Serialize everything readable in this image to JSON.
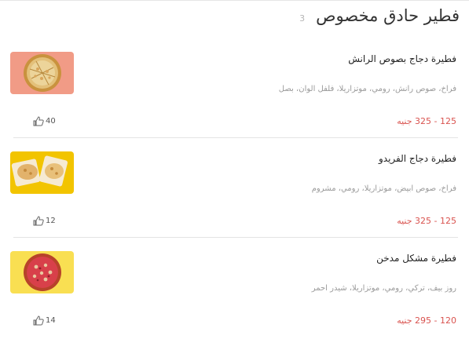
{
  "section": {
    "title": "فطير حادق مخصوص",
    "count": "3"
  },
  "items": [
    {
      "name": "فطيرة دجاج بصوص الرانش",
      "description": "فراخ، صوص رانش، رومي، موتزاريلا، فلفل الوان، بصل",
      "price": "125 - 325 جنيه",
      "likes": "40",
      "image_bg": "#f19b86",
      "image_icon": "pizza-ranch-image"
    },
    {
      "name": "فطيرة دجاج الفريدو",
      "description": "فراخ، صوص ابيض، موتزاريلا، رومي، مشروم",
      "price": "125 - 325 جنيه",
      "likes": "12",
      "image_bg": "#f2c400",
      "image_icon": "pizza-alfredo-image"
    },
    {
      "name": "فطيرة مشكل مدخن",
      "description": "روز بيف، تركي، رومي، موتزاريلا، شيدر احمر",
      "price": "120 - 295 جنيه",
      "likes": "14",
      "image_bg": "#f9df52",
      "image_icon": "pizza-smoked-image"
    }
  ]
}
